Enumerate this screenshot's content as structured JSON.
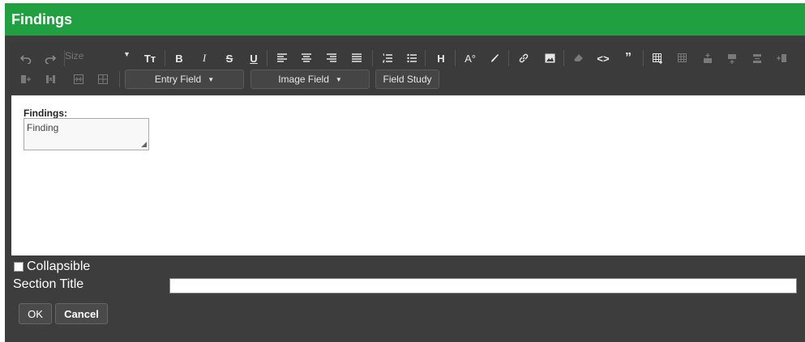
{
  "dialog": {
    "title": "Findings"
  },
  "toolbar": {
    "size_label": "Size",
    "dropdowns": {
      "entry_field": "Entry Field",
      "image_field": "Image Field"
    },
    "field_study": "Field Study",
    "glyphs": {
      "text_size": "Tт",
      "bold": "B",
      "italic": "I",
      "strike": "S",
      "underline": "U",
      "heading": "H",
      "font_color": "A°",
      "code": "<>",
      "quote": "”"
    }
  },
  "editor": {
    "field_label": "Findings:",
    "field_value": "Finding"
  },
  "footer": {
    "collapsible_label": "Collapsible",
    "section_title_label": "Section Title",
    "section_title_value": "",
    "ok_label": "OK",
    "cancel_label": "Cancel"
  }
}
